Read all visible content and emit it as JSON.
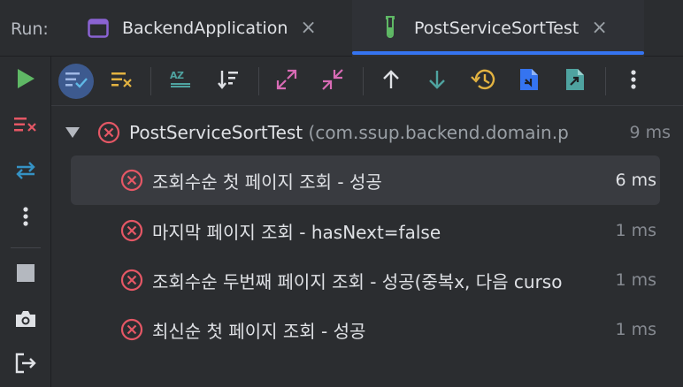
{
  "tabbar": {
    "run_label": "Run:",
    "tabs": [
      {
        "label": "BackendApplication",
        "icon": "application-window-icon",
        "close": "×"
      },
      {
        "label": "PostServiceSortTest",
        "icon": "test-tube-icon",
        "close": "×"
      }
    ]
  },
  "colors": {
    "accent": "#3574f0",
    "error": "#e55765",
    "run_green": "#5fb865",
    "active_button": "#3d5a8f"
  },
  "tree": {
    "root": {
      "name": "PostServiceSortTest",
      "package": "(com.ssup.backend.domain.p",
      "time": "9 ms",
      "status": "failed"
    },
    "items": [
      {
        "name": "조회수순 첫 페이지 조회 - 성공",
        "time": "6 ms",
        "status": "failed"
      },
      {
        "name": "마지막 페이지 조회 - hasNext=false",
        "time": "1 ms",
        "status": "failed"
      },
      {
        "name": "조회수순 두번째 페이지 조회 - 성공(중복x, 다음 curso",
        "time": "1 ms",
        "status": "failed"
      },
      {
        "name": "최신순 첫 페이지 조회 - 성공",
        "time": "1 ms",
        "status": "failed"
      }
    ]
  }
}
